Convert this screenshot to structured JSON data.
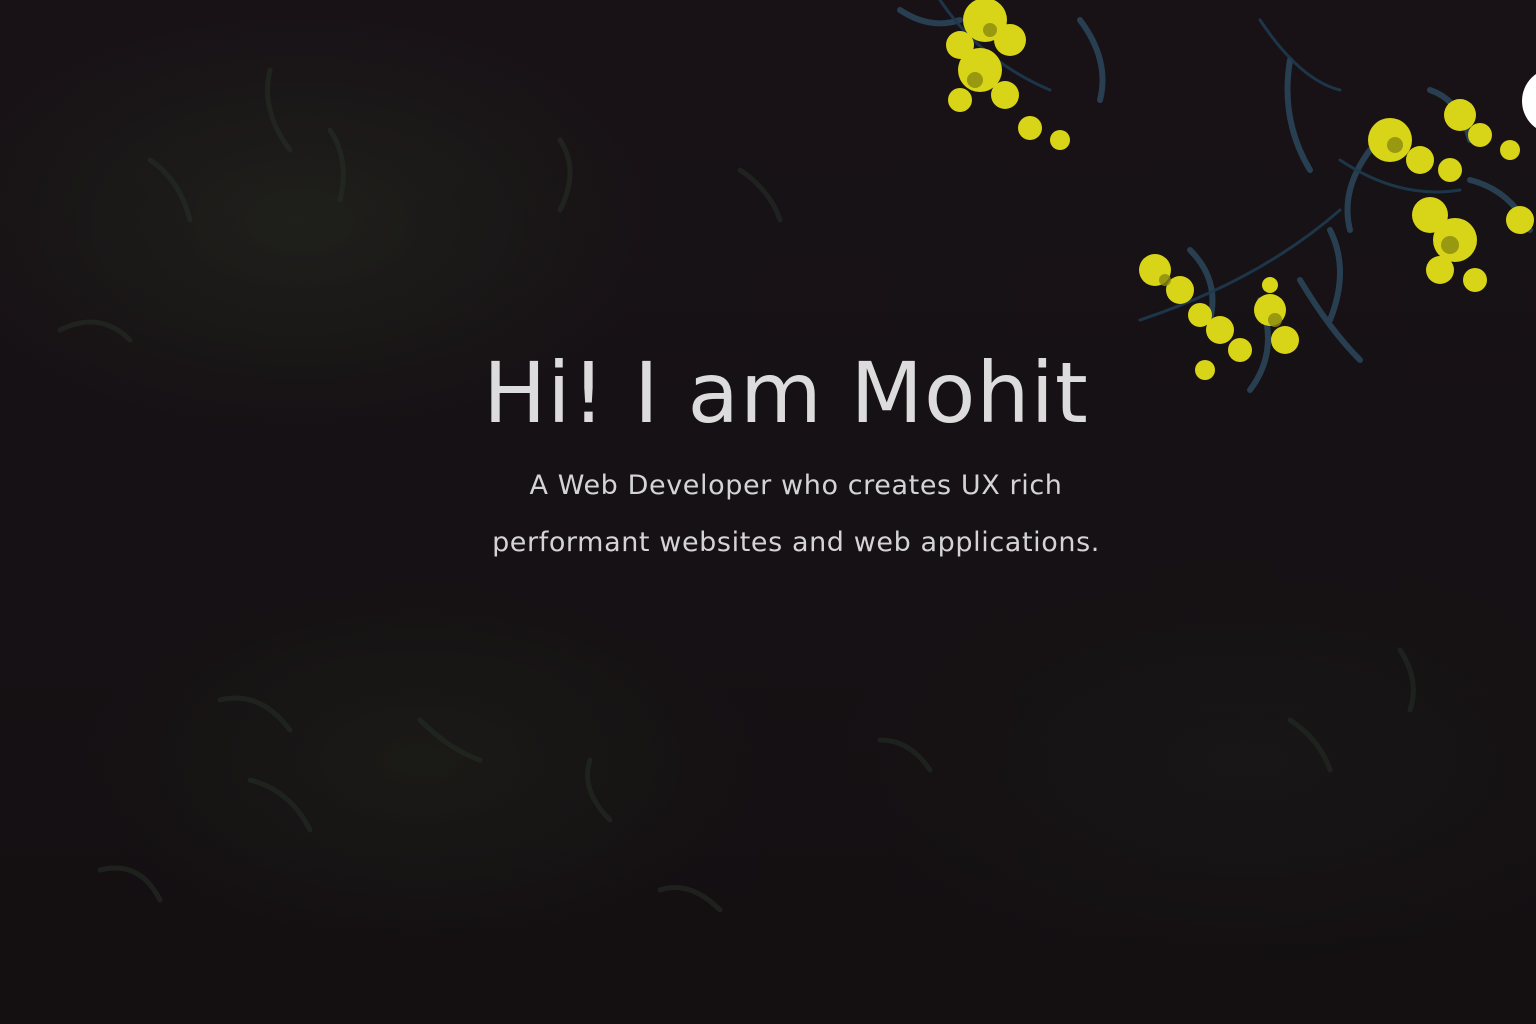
{
  "hero": {
    "heading": "Hi! I am Mohit",
    "tagline_line1": "A Web Developer who creates UX rich",
    "tagline_line2": "performant websites and web applications."
  },
  "colors": {
    "background": "#161114",
    "text": "#dcdcdc",
    "flowers": "#d8d418",
    "foliage": "#2f4a5e"
  },
  "corner_button": {
    "icon": "white-circle-menu-icon"
  }
}
